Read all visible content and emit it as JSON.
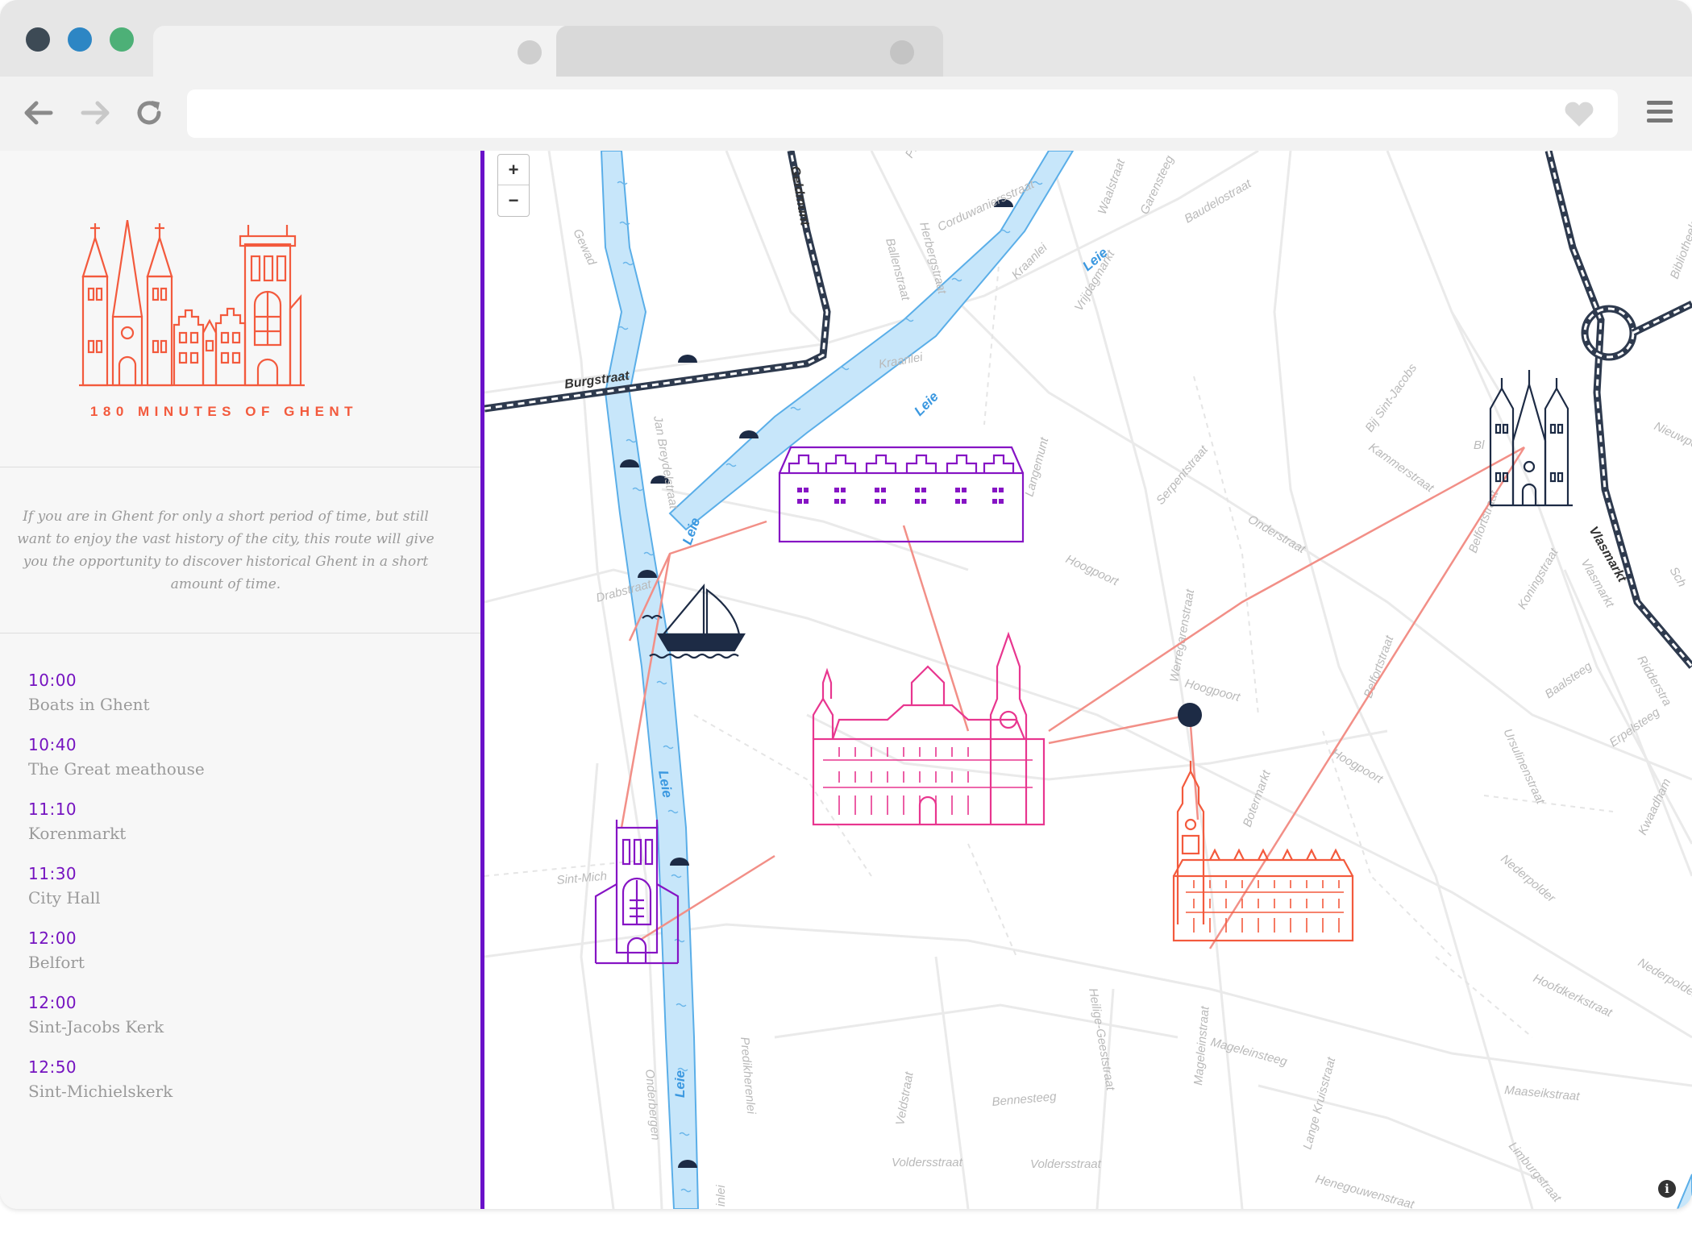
{
  "browser": {
    "window_controls": [
      "close",
      "minimize",
      "maximize"
    ],
    "url": "",
    "icons": {
      "back": "arrow-left-icon",
      "forward": "arrow-right-icon",
      "reload": "reload-icon",
      "favorite": "heart-icon",
      "menu": "hamburger-menu-icon"
    }
  },
  "sidebar": {
    "logo_title": "180 MINUTES OF GHENT",
    "intro": "If you are in Ghent for only a short period of time, but still want to enjoy the vast history of the city, this route will give you the opportunity to discover historical Ghent in a short amount of time.",
    "schedule": [
      {
        "time": "10:00",
        "name": "Boats in Ghent"
      },
      {
        "time": "10:40",
        "name": "The Great meathouse"
      },
      {
        "time": "11:10",
        "name": "Korenmarkt"
      },
      {
        "time": "11:30",
        "name": "City Hall"
      },
      {
        "time": "12:00",
        "name": "Belfort"
      },
      {
        "time": "12:00",
        "name": "Sint-Jacobs Kerk"
      },
      {
        "time": "12:50",
        "name": "Sint-Michielskerk"
      }
    ]
  },
  "map": {
    "zoom_in": "+",
    "zoom_out": "−",
    "info": "i",
    "streets": {
      "burgstraat": "Burgstraat",
      "geldmunt": "Geldmunt",
      "gewad": "Gewad",
      "ballenstraat": "Ballenstraat",
      "herbergstraat": "Herbergstraat",
      "corduwaniersstraat": "Corduwaniersstraat",
      "waalstraat": "Waalstraat",
      "garensteeg": "Garensteeg",
      "baudelostraat": "Baudelostraat",
      "bibliotheek": "Bibliotheek",
      "kraanlei": "Kraanlei",
      "kraanlei2": "Kraanlei",
      "vrijdagmarkt": "Vrijdagmarkt",
      "bij_sint_jacobs": "Bij Sint-Jacobs",
      "nieuwpoort": "Nieuwpo",
      "jan_breydelstraat": "Jan Breydelstraat",
      "drabstraat": "Drabstraat",
      "langemunt": "Langemunt",
      "serpentstraat": "Serpentstraat",
      "kammerstraat": "Kammerstraat",
      "onderstraat": "Onderstraat",
      "belfortstraat": "Belfortstraat",
      "koningstraat": "Koningstraat",
      "vlasmarkt": "Vlasmarkt",
      "hoogpoort": "Hoogpoort",
      "hoogpoort2": "Hoogpoort",
      "hoogpoort3": "Hoogpoort",
      "werregarenstraat": "Werregarenstraat",
      "belfortstraat2": "Belfortstraat",
      "baalsteeg": "Baalsteeg",
      "ridderstraat": "Ridderstra",
      "erpelsteeg": "Erpelsteeg",
      "ursulinenstraat": "Ursulinenstraat",
      "kwaadham": "Kwaadham",
      "botermarkt": "Botermarkt",
      "nederpolder": "Nederpolder",
      "nederpolder2": "Nederpolder",
      "hoofdkerkstraat": "Hoofdkerkstraat",
      "sint_michiel": "Sint-Mich",
      "predikherenlei": "Predikherenlei",
      "onderbergen": "Onderbergen",
      "veldstraat": "Veldstraat",
      "heilige_geeststraat": "Heilige-Geeststraat",
      "magelein": "Mageleinstraat",
      "mageleinsteeg": "Mageleinsteeg",
      "bennesteeg": "Bennesteeg",
      "lange_kruisstraat": "Lange Kruisstraat",
      "maaseikstraat": "Maaseikstraat",
      "limburgstraat": "Limburgstraat",
      "voldersstraat": "Voldersstraat",
      "voldersstraat2": "Voldersstraat",
      "henegouwenstraat": "Henegouwenstraat",
      "leie1": "Leie",
      "leie2": "Leie",
      "leie3": "Leie",
      "leie4": "Leie",
      "leie5": "Leie",
      "leie6": "Leie",
      "pl": "Pl",
      "bl": "Bl",
      "lei": "inlei",
      "sch": "Sch"
    },
    "landmark_icons": [
      "sailboat-icon",
      "great-meathouse-icon",
      "city-hall-icon",
      "sint-jacobs-church-icon",
      "belfort-icon",
      "sint-michiels-church-icon",
      "current-location-marker"
    ],
    "colors": {
      "route_line": "#f28f87",
      "river": "#9fd2f5",
      "river_border": "#5aaee8",
      "purple": "#8614c4",
      "magenta": "#e8368f",
      "coral": "#f35a3d",
      "navy": "#1d2b45"
    }
  }
}
